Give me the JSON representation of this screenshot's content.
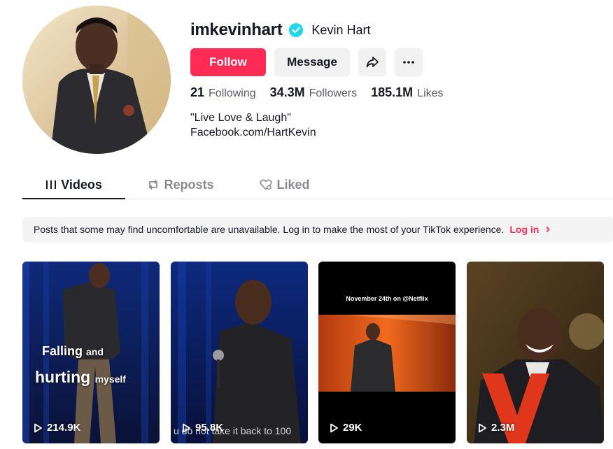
{
  "profile": {
    "username": "imkevinhart",
    "nickname": "Kevin Hart",
    "verified": true
  },
  "actions": {
    "follow_label": "Follow",
    "message_label": "Message",
    "share_icon": "share-icon",
    "more_icon": "more-icon"
  },
  "stats": {
    "following_count": "21",
    "following_label": "Following",
    "followers_count": "34.3M",
    "followers_label": "Followers",
    "likes_count": "185.1M",
    "likes_label": "Likes"
  },
  "bio": {
    "line1": "\"Live Love & Laugh\"",
    "line2": "Facebook.com/HartKevin"
  },
  "tabs": [
    {
      "label": "Videos",
      "icon": "grid-icon",
      "active": true
    },
    {
      "label": "Reposts",
      "icon": "repost-icon",
      "active": false
    },
    {
      "label": "Liked",
      "icon": "liked-icon",
      "active": false
    }
  ],
  "notice": {
    "text": "Posts that some may find uncomfortable are unavailable. Log in to make the most of your TikTok experience.",
    "link_label": "Log in",
    "link_icon": "chevron-right-icon"
  },
  "videos": [
    {
      "views": "214.9K",
      "overlay_big_1": "Falling",
      "overlay_small_1": "and",
      "overlay_big_2": "hurting",
      "overlay_small_2": "myself"
    },
    {
      "views": "95.8K",
      "caption": "u do not take it back to 100"
    },
    {
      "views": "29K",
      "overlay_top": "November 24th on @Netflix"
    },
    {
      "views": "2.3M"
    }
  ],
  "colors": {
    "accent": "#fe2c55",
    "verified": "#20d5ec",
    "text": "#161823",
    "muted": "#5a5b63"
  }
}
